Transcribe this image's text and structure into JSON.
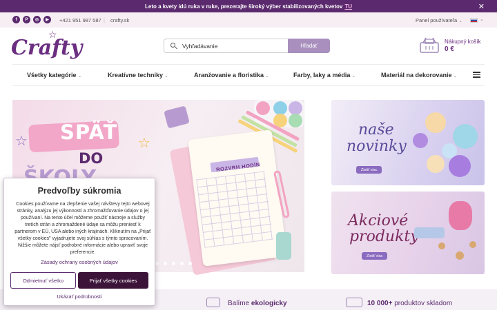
{
  "topbar": {
    "message": "Leto a kvety idú ruka v ruke, prezerajte široký výber stabilizovaných kvetov",
    "link": "TU"
  },
  "contact": {
    "social": [
      {
        "icon": "facebook-icon",
        "glyph": "f"
      },
      {
        "icon": "pinterest-icon",
        "glyph": "P"
      },
      {
        "icon": "instagram-icon",
        "glyph": "◎"
      },
      {
        "icon": "youtube-icon",
        "glyph": "▶"
      }
    ],
    "phone": "+421 951 987 587",
    "separator": "|",
    "website": "crafty.sk",
    "user_panel": "Panel používateľa",
    "caret": "⌄"
  },
  "header": {
    "logo_text": "Crafty",
    "search_placeholder": "Vyhľadávanie",
    "search_button": "Hľadať",
    "cart_label": "Nákupný košík",
    "cart_value": "0 €"
  },
  "nav": {
    "items": [
      {
        "label": "Všetky kategórie"
      },
      {
        "label": "Kreatívne techniky"
      },
      {
        "label": "Aranžovanie a floristika"
      },
      {
        "label": "Farby, laky a média"
      },
      {
        "label": "Materiál na dekorovanie"
      }
    ]
  },
  "hero": {
    "line1": "SPÄŤ",
    "line2": "DO",
    "line3": "ŠKOLY",
    "notebook_title": "ROZVRH HODÍN"
  },
  "side_banners": [
    {
      "title_line1": "naše",
      "title_line2": "novinky",
      "button": "Zistiť viac"
    },
    {
      "title_line1": "Akciové",
      "title_line2": "produkty",
      "button": "Zistiť viac"
    }
  ],
  "benefits": [
    {
      "text_plain": "Balíme ",
      "text_bold": "ekologicky",
      "icon": "eco-box-icon"
    },
    {
      "text_plain": " produktov skladom",
      "text_bold": "10 000+",
      "icon": "truck-icon"
    }
  ],
  "cookie": {
    "title": "Predvoľby súkromia",
    "text": "Cookies používame na zlepšenie vašej návštevy tejto webovej stránky, analýzu jej výkonnosti a zhromažďovanie údajov o jej používaní. Na tento účel môžeme použiť nástroje a služby tretích strán a zhromaždené údaje sa môžu preniesť k partnerom v EÚ, USA alebo iných krajinách. Kliknutím na „Prijať všetky cookies\" vyjadrujete svoj súhlas s týmto spracovaním. Nižšie môžete nájsť podrobné informácie alebo upraviť svoje preferencie.",
    "policy_link": "Zásady ochrany osobných údajov",
    "deny_button": "Odmietnuť všetko",
    "accept_button": "Prijať všetky cookies",
    "details_link": "Ukázať podrobnosti"
  },
  "colors": {
    "brand": "#5b2a6e",
    "accent": "#a88fbe",
    "cookie_accept": "#3c1339"
  }
}
